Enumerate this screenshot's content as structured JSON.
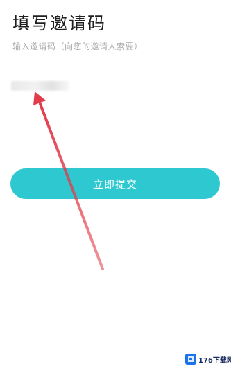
{
  "page": {
    "title": "填写邀请码",
    "hint": "输入邀请码（向您的邀请人索要）"
  },
  "invite_code": {
    "value": "",
    "placeholder": ""
  },
  "submit": {
    "label": "立即提交"
  },
  "watermark": {
    "text": "176下载网"
  },
  "colors": {
    "accent": "#2ec9d0",
    "annotation_arrow": "#e23b4a",
    "hint_text": "#a9a9a9",
    "watermark_logo": "#1a73e8"
  },
  "icons": {
    "annotation": "arrow-up-icon",
    "watermark": "watermark-logo-icon"
  }
}
